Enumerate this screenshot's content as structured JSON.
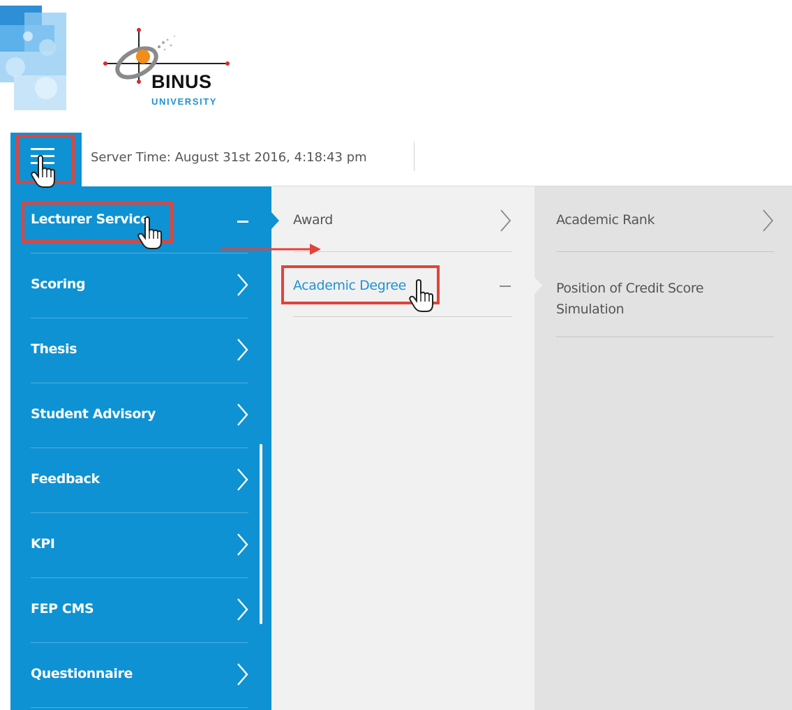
{
  "brand": {
    "name": "BINUS",
    "sub": "UNIVERSITY"
  },
  "topbar": {
    "server_time": "Server Time: August 31st 2016, 4:18:43 pm"
  },
  "menu_level1": [
    {
      "label": "Lecturer Service",
      "state": "expanded"
    },
    {
      "label": "Scoring",
      "state": "collapsed"
    },
    {
      "label": "Thesis",
      "state": "collapsed"
    },
    {
      "label": "Student Advisory",
      "state": "collapsed"
    },
    {
      "label": "Feedback",
      "state": "collapsed"
    },
    {
      "label": "KPI",
      "state": "collapsed"
    },
    {
      "label": "FEP CMS",
      "state": "collapsed"
    },
    {
      "label": "Questionnaire",
      "state": "collapsed"
    }
  ],
  "menu_level2": [
    {
      "label": "Award",
      "state": "collapsed"
    },
    {
      "label": "Academic Degree",
      "state": "expanded"
    }
  ],
  "menu_level3": [
    {
      "label": "Academic Rank",
      "state": "collapsed"
    },
    {
      "label": "Position of Credit Score Simulation"
    }
  ],
  "icons": {
    "menu": "hamburger-icon",
    "expand": "chevron-right-icon",
    "collapse": "minus-icon",
    "cursor": "hand-pointer-icon"
  },
  "colors": {
    "accent": "#0e92d3",
    "annotation": "#e2433b",
    "active_link": "#1e93d3",
    "panel_light": "#f1f1f1",
    "panel_grey": "#e2e2e2"
  }
}
